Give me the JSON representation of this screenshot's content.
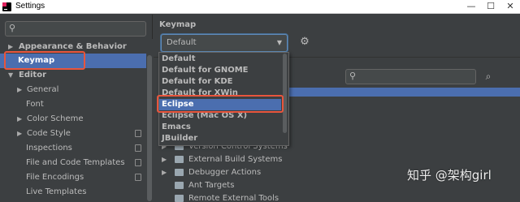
{
  "window": {
    "title": "Settings",
    "controls": [
      "—",
      "☐",
      "✕"
    ]
  },
  "sidebar": {
    "search_placeholder": "",
    "items": [
      {
        "label": "Appearance & Behavior",
        "arrow": "▶",
        "bold": true,
        "level": 0
      },
      {
        "label": "Keymap",
        "arrow": "",
        "bold": true,
        "level": 0,
        "selected": true
      },
      {
        "label": "Editor",
        "arrow": "▼",
        "bold": true,
        "level": 0
      },
      {
        "label": "General",
        "arrow": "▶",
        "bold": false,
        "level": 1
      },
      {
        "label": "Font",
        "arrow": "",
        "bold": false,
        "level": 1
      },
      {
        "label": "Color Scheme",
        "arrow": "▶",
        "bold": false,
        "level": 1
      },
      {
        "label": "Code Style",
        "arrow": "▶",
        "bold": false,
        "level": 1,
        "copy_icon": true
      },
      {
        "label": "Inspections",
        "arrow": "",
        "bold": false,
        "level": 1,
        "copy_icon": true
      },
      {
        "label": "File and Code Templates",
        "arrow": "",
        "bold": false,
        "level": 1,
        "copy_icon": true
      },
      {
        "label": "File Encodings",
        "arrow": "",
        "bold": false,
        "level": 1,
        "copy_icon": true
      },
      {
        "label": "Live Templates",
        "arrow": "",
        "bold": false,
        "level": 1
      }
    ]
  },
  "main": {
    "heading": "Keymap",
    "keymap_combo": {
      "value": "Default",
      "arrow": "▼"
    },
    "gear_icon": "gear-icon",
    "search_placeholder": "",
    "actions": [
      {
        "label": "Version Control Systems"
      },
      {
        "label": "External Build Systems"
      },
      {
        "label": "Debugger Actions"
      },
      {
        "label": "Ant Targets"
      },
      {
        "label": "Remote External Tools"
      }
    ]
  },
  "dropdown": {
    "options": [
      {
        "label": "Default"
      },
      {
        "label": "Default for GNOME"
      },
      {
        "label": "Default for KDE"
      },
      {
        "label": "Default for XWin"
      },
      {
        "label": "Eclipse",
        "selected": true
      },
      {
        "label": "Eclipse (Mac OS X)"
      },
      {
        "label": "Emacs"
      },
      {
        "label": "JBuilder"
      }
    ]
  },
  "watermark": "知乎 @架构girl",
  "colors": {
    "background": "#3c3f41",
    "selection": "#4b6eaf",
    "highlight_box": "#e8553d",
    "text": "#bbbbbb"
  }
}
